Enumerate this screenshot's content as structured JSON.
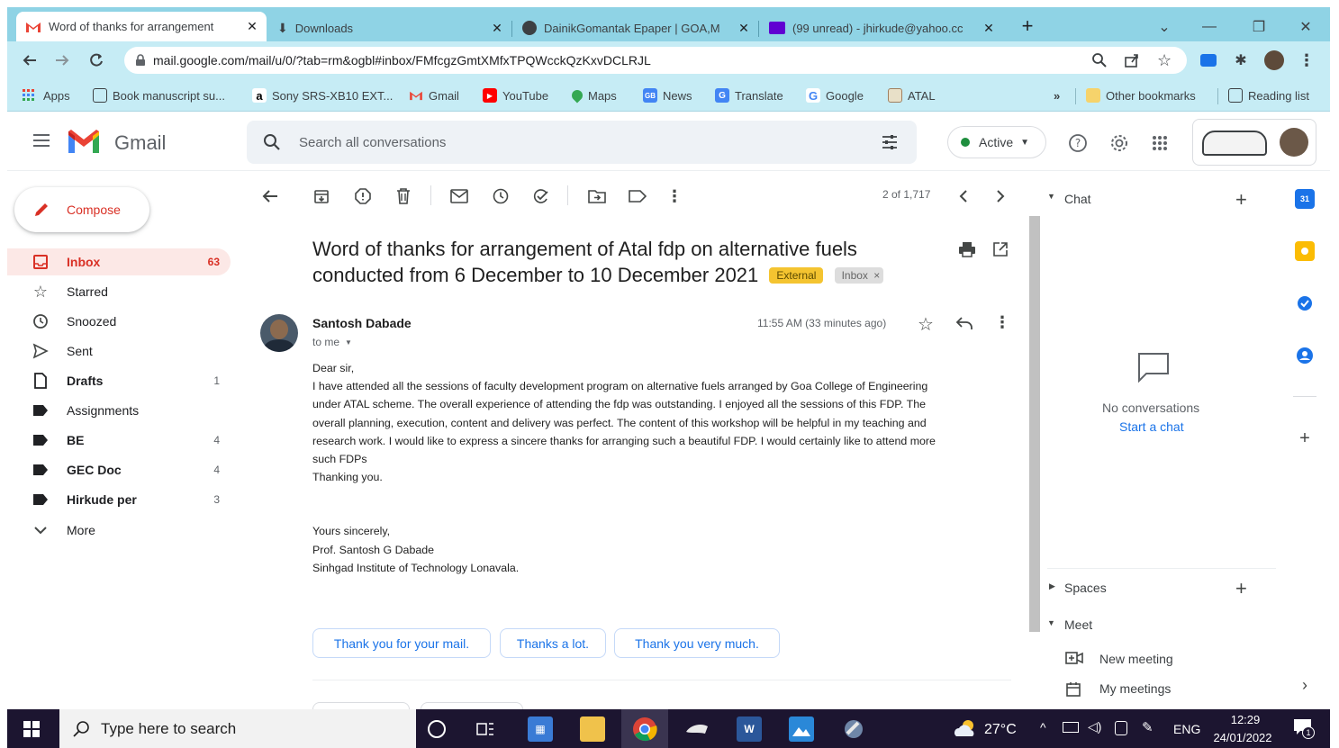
{
  "browser": {
    "tabs": [
      {
        "title": "Word of thanks for arrangement",
        "active": true
      },
      {
        "title": "Downloads",
        "active": false
      },
      {
        "title": "DainikGomantak Epaper | GOA,M",
        "active": false
      },
      {
        "title": "(99 unread) - jhirkude@yahoo.cc",
        "active": false
      }
    ],
    "new_tab": "+",
    "url": "mail.google.com/mail/u/0/?tab=rm&ogbl#inbox/FMfcgzGmtXMfxTPQWcckQzKxvDCLRJL",
    "bookmarks": [
      "Apps",
      "Book manuscript su...",
      "Sony SRS-XB10 EXT...",
      "Gmail",
      "YouTube",
      "Maps",
      "News",
      "Translate",
      "Google",
      "ATAL"
    ],
    "overflow": "»",
    "other_bookmarks": "Other bookmarks",
    "reading_list": "Reading list"
  },
  "gmail": {
    "logo_text": "Gmail",
    "search_placeholder": "Search all conversations",
    "status": "Active",
    "compose": "Compose",
    "nav": [
      {
        "label": "Inbox",
        "count": "63"
      },
      {
        "label": "Starred",
        "count": ""
      },
      {
        "label": "Snoozed",
        "count": ""
      },
      {
        "label": "Sent",
        "count": ""
      },
      {
        "label": "Drafts",
        "count": "1"
      },
      {
        "label": "Assignments",
        "count": ""
      },
      {
        "label": "BE",
        "count": "4"
      },
      {
        "label": "GEC Doc",
        "count": "4"
      },
      {
        "label": "Hirkude per",
        "count": "3"
      },
      {
        "label": "More",
        "count": ""
      }
    ],
    "pagination": "2 of 1,717"
  },
  "email": {
    "subject_line1": "Word of thanks for arrangement of Atal fdp on alternative fuels",
    "subject_line2": "conducted from 6 December to 10 December 2021",
    "badge_external": "External",
    "badge_inbox": "Inbox",
    "sender": "Santosh Dabade",
    "to": "to me",
    "time": "11:55 AM (33 minutes ago)",
    "greeting": "Dear sir,",
    "body_lines": [
      "I have attended all the sessions of faculty development program on alternative fuels arranged by Goa College of Engineering",
      "under ATAL scheme. The overall experience of attending the fdp was outstanding. I enjoyed all the sessions of this FDP. The",
      "overall planning, execution, content and delivery was perfect. The content of this workshop will be helpful in my teaching and",
      "research work. I would like to express a sincere thanks for arranging such a beautiful FDP. I would certainly like to attend more",
      "such FDPs"
    ],
    "thanking": "Thanking you.",
    "closing": "Yours sincerely,",
    "signature_name": "Prof. Santosh G Dabade",
    "signature_org": "Sinhgad Institute of Technology Lonavala.",
    "smart_replies": [
      "Thank you for your mail.",
      "Thanks a lot.",
      "Thank you very much."
    ]
  },
  "chat_panel": {
    "chat_header": "Chat",
    "no_conversations": "No conversations",
    "start_chat": "Start a chat",
    "spaces": "Spaces",
    "meet": "Meet",
    "new_meeting": "New meeting",
    "my_meetings": "My meetings"
  },
  "taskbar": {
    "search_placeholder": "Type here to search",
    "temperature": "27°C",
    "language": "ENG",
    "time": "12:29",
    "date": "24/01/2022",
    "notification_count": "1"
  },
  "colors": {
    "gmail_red": "#d93025",
    "link_blue": "#1a73e8",
    "external_badge": "#f4c430",
    "tab_strip": "#8fd3e5",
    "toolbar_bg": "#c6ecf5",
    "taskbar_bg": "#1c1530"
  }
}
